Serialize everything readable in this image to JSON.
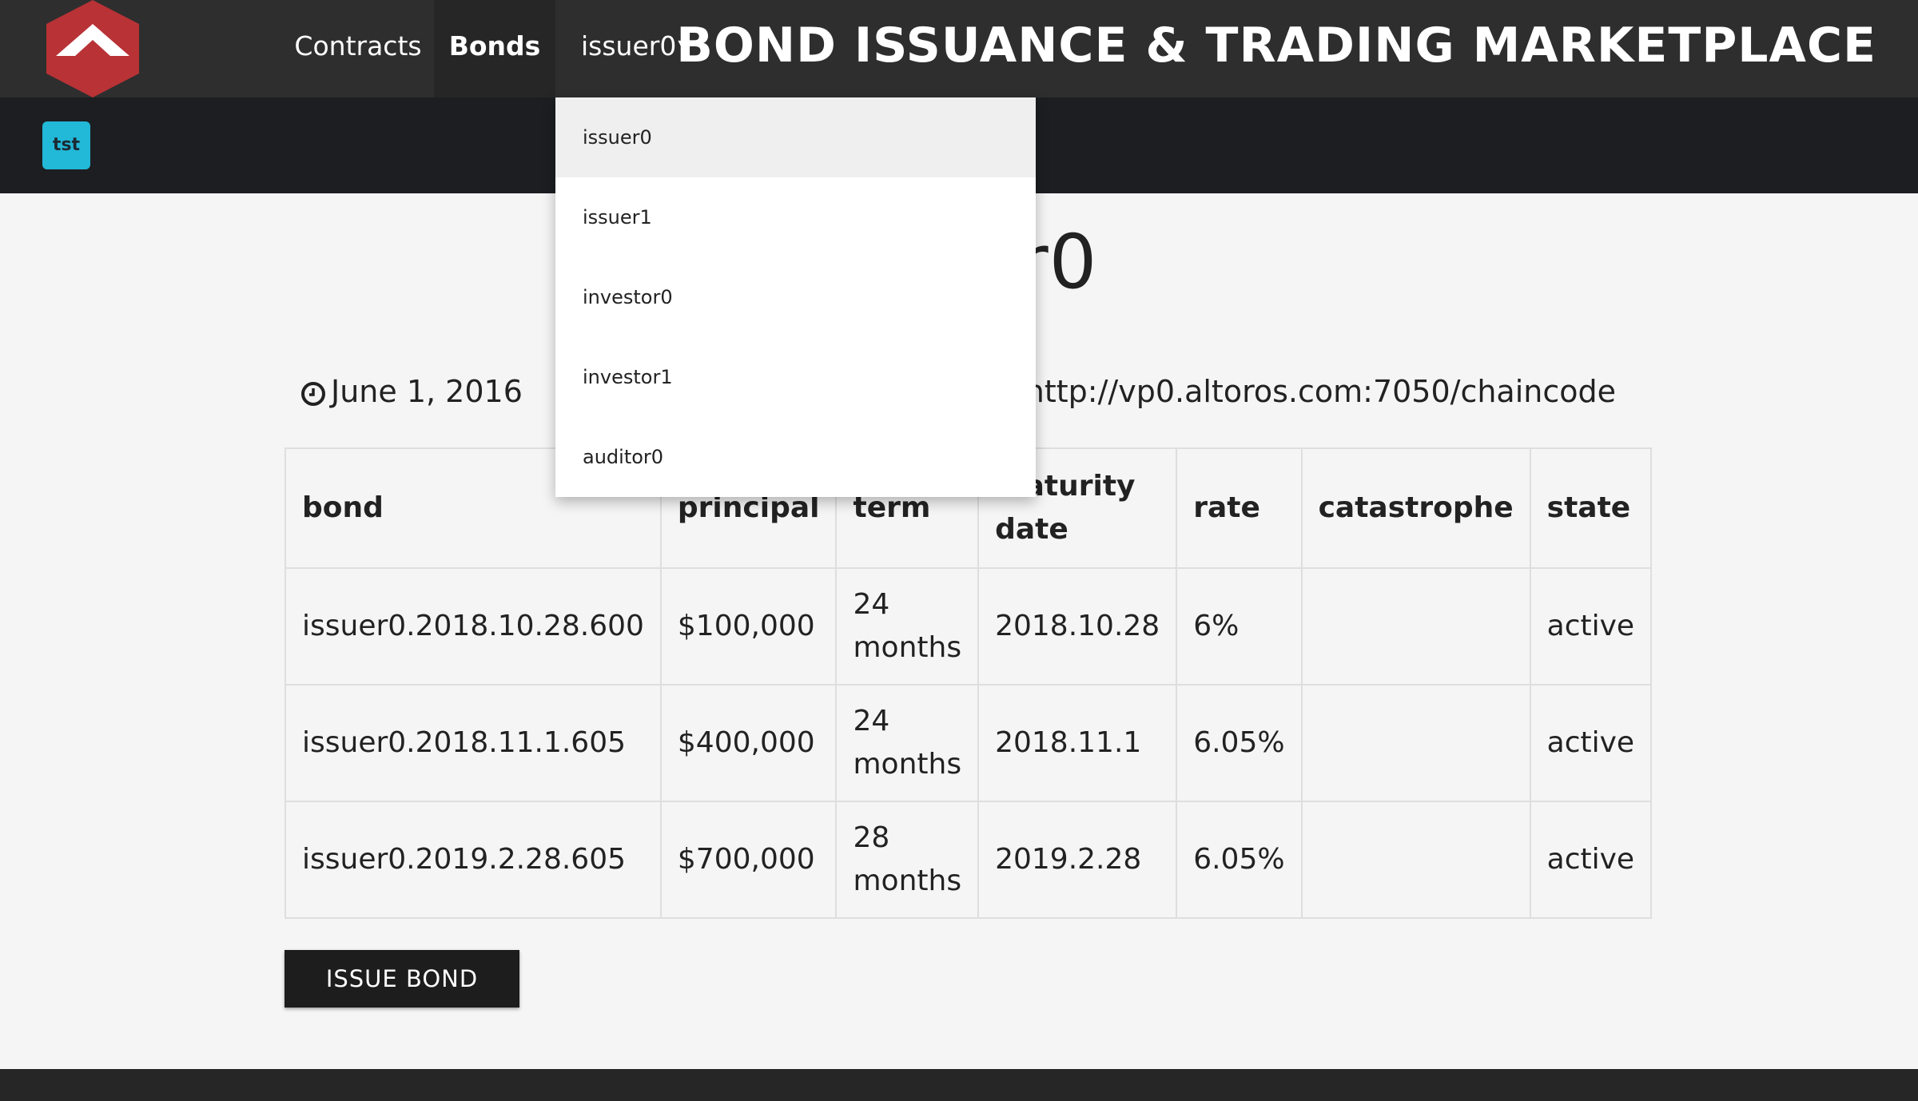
{
  "nav": {
    "items": [
      {
        "label": "Contracts"
      },
      {
        "label": "Bonds"
      }
    ],
    "user_menu_label": "issuer0",
    "app_title": "BOND ISSUANCE & TRADING MARKETPLACE"
  },
  "subbar": {
    "badge": "tst"
  },
  "page": {
    "title": "issuer0",
    "date": "June 1, 2016",
    "url": "http://vp0.altoros.com:7050/chaincode"
  },
  "table": {
    "headers": [
      "bond",
      "principal",
      "term",
      "maturity date",
      "rate",
      "catastrophe",
      "state"
    ],
    "rows": [
      {
        "bond": "issuer0.2018.10.28.600",
        "principal": "$100,000",
        "term": "24 months",
        "maturity": "2018.10.28",
        "rate": "6%",
        "catastrophe": "",
        "state": "active"
      },
      {
        "bond": "issuer0.2018.11.1.605",
        "principal": "$400,000",
        "term": "24 months",
        "maturity": "2018.11.1",
        "rate": "6.05%",
        "catastrophe": "",
        "state": "active"
      },
      {
        "bond": "issuer0.2019.2.28.605",
        "principal": "$700,000",
        "term": "28 months",
        "maturity": "2019.2.28",
        "rate": "6.05%",
        "catastrophe": "",
        "state": "active"
      }
    ]
  },
  "actions": {
    "issue_bond": "ISSUE BOND"
  },
  "dropdown": {
    "items": [
      "issuer0",
      "issuer1",
      "investor0",
      "investor1",
      "auditor0"
    ],
    "selected": "issuer0"
  },
  "colors": {
    "topnav": "#2e2e2e",
    "subbar": "#1c1e22",
    "logo": "#b83236",
    "badge": "#22b8d8",
    "button": "#1d1d1d",
    "page_bg": "#f5f5f5"
  }
}
